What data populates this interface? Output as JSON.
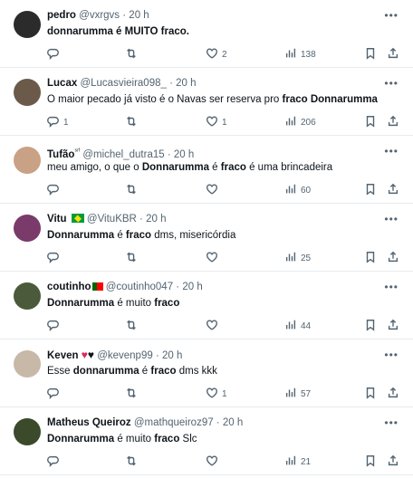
{
  "tweets": [
    {
      "name": "pedro",
      "handle": "@vxrgvs",
      "time": "20 h",
      "text": [
        {
          "t": "donnarumma é MUITO fraco.",
          "b": true
        }
      ],
      "replies": "",
      "retweets": "",
      "likes": "2",
      "views": "138"
    },
    {
      "name": "Lucax",
      "handle": "@Lucasvieira098_",
      "time": "20 h",
      "text": [
        {
          "t": "O maior pecado já visto é o Navas ser reserva pro ",
          "b": false
        },
        {
          "t": "fraco Donnarumma",
          "b": true
        }
      ],
      "replies": "1",
      "retweets": "",
      "likes": "1",
      "views": "206"
    },
    {
      "name": "Tufão",
      "name_sup": "ˢʳᶠ",
      "handle": "@michel_dutra15",
      "time": "20 h",
      "text": [
        {
          "t": "meu amigo, o que o ",
          "b": false
        },
        {
          "t": "Donnarumma",
          "b": true
        },
        {
          "t": " é ",
          "b": false
        },
        {
          "t": "fraco",
          "b": true
        },
        {
          "t": " é uma brincadeira",
          "b": false
        }
      ],
      "replies": "",
      "retweets": "",
      "likes": "",
      "views": "60"
    },
    {
      "name": "Vitu",
      "flag": "br",
      "handle": "@VituKBR",
      "time": "20 h",
      "text": [
        {
          "t": "Donnarumma",
          "b": true
        },
        {
          "t": " é ",
          "b": false
        },
        {
          "t": "fraco",
          "b": true
        },
        {
          "t": " dms, misericórdia",
          "b": false
        }
      ],
      "replies": "",
      "retweets": "",
      "likes": "",
      "views": "25"
    },
    {
      "name": "coutinho",
      "flag": "pt",
      "handle": "@coutinho047",
      "time": "20 h",
      "text": [
        {
          "t": "Donnarumma",
          "b": true
        },
        {
          "t": " é muito ",
          "b": false
        },
        {
          "t": "fraco",
          "b": true
        }
      ],
      "replies": "",
      "retweets": "",
      "likes": "",
      "views": "44"
    },
    {
      "name": "Keven",
      "hearts": true,
      "handle": "@kevenp99",
      "time": "20 h",
      "text": [
        {
          "t": "Esse ",
          "b": false
        },
        {
          "t": "donnarumma",
          "b": true
        },
        {
          "t": " é ",
          "b": false
        },
        {
          "t": "fraco",
          "b": true
        },
        {
          "t": " dms kkk",
          "b": false
        }
      ],
      "replies": "",
      "retweets": "",
      "likes": "1",
      "views": "57"
    },
    {
      "name": "Matheus Queiroz",
      "handle": "@mathqueiroz97",
      "time": "20 h",
      "text": [
        {
          "t": "Donnarumma",
          "b": true
        },
        {
          "t": " é muito ",
          "b": false
        },
        {
          "t": "fraco",
          "b": true
        },
        {
          "t": " Slc",
          "b": false
        }
      ],
      "replies": "",
      "retweets": "",
      "likes": "",
      "views": "21"
    }
  ],
  "colors": {
    "text": "#0f1419",
    "muted": "#536471",
    "border": "#e6ecf0"
  },
  "icons": {
    "reply": "reply-icon",
    "retweet": "retweet-icon",
    "like": "heart-icon",
    "views": "views-icon",
    "bookmark": "bookmark-icon",
    "share": "share-icon",
    "more": "more-icon"
  }
}
